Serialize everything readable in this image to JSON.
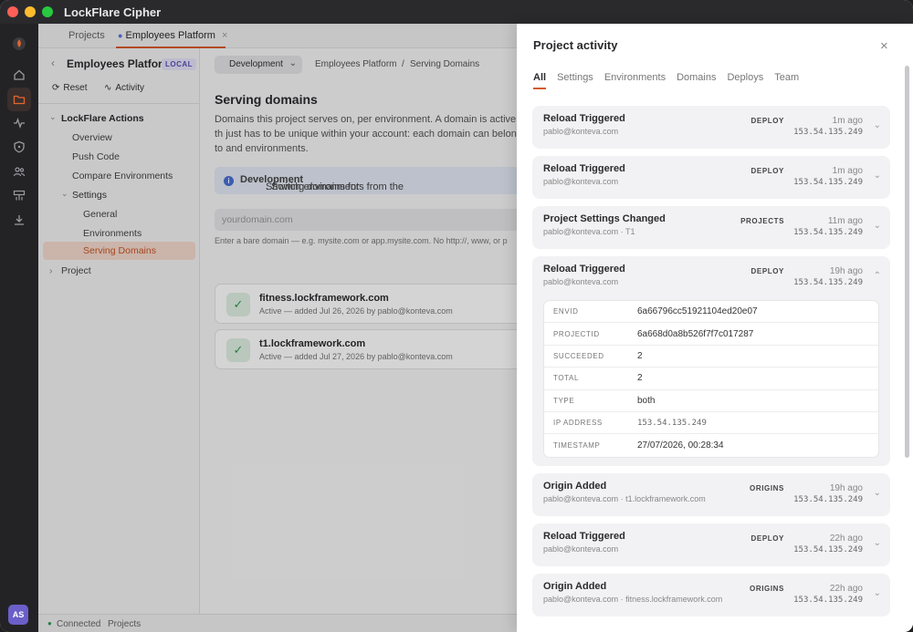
{
  "app": {
    "title": "LockFlare Cipher",
    "avatar": "AS"
  },
  "tabs": [
    {
      "label": "Projects"
    },
    {
      "label": "Employees Platform",
      "close": "×"
    }
  ],
  "sidebar": {
    "project_title": "Employees Platform",
    "badge": "LOCAL",
    "reset": "Reset",
    "activity": "Activity",
    "tree": [
      {
        "label": "LockFlare Actions"
      },
      {
        "label": "Overview"
      },
      {
        "label": "Push Code"
      },
      {
        "label": "Compare Environments"
      },
      {
        "label": "Settings"
      },
      {
        "label": "General"
      },
      {
        "label": "Environments"
      },
      {
        "label": "Serving Domains"
      },
      {
        "label": "Project"
      }
    ]
  },
  "main": {
    "env_button": "Development",
    "breadcrumb": [
      "Employees Platform",
      "/",
      "Serving Domains"
    ],
    "heading": "Serving domains",
    "description": "Domains this project serves on, per environment. A domain is active th just has to be unique within your account: each domain can belong to and environments.",
    "info_prefix": "Showing domains for ",
    "info_env": "Development",
    "info_suffix": ". Switch environments from the",
    "domain_placeholder": "yourdomain.com",
    "hint": "Enter a bare domain — e.g. mysite.com or app.mysite.com. No http://, www, or p",
    "domains": [
      {
        "name": "fitness.lockframework.com",
        "sub": "Active — added Jul 26, 2026 by pablo@konteva.com"
      },
      {
        "name": "t1.lockframework.com",
        "sub": "Active — added Jul 27, 2026 by pablo@konteva.com"
      }
    ]
  },
  "statusbar": {
    "connected": "Connected",
    "projects": "Projects"
  },
  "panel": {
    "title": "Project activity",
    "tabs": [
      "All",
      "Settings",
      "Environments",
      "Domains",
      "Deploys",
      "Team"
    ],
    "events": [
      {
        "title": "Reload Triggered",
        "sub": "pablo@konteva.com",
        "badge": "DEPLOY",
        "time": "1m ago",
        "ip": "153.54.135.249"
      },
      {
        "title": "Reload Triggered",
        "sub": "pablo@konteva.com",
        "badge": "DEPLOY",
        "time": "1m ago",
        "ip": "153.54.135.249"
      },
      {
        "title": "Project Settings Changed",
        "sub": "pablo@konteva.com · T1",
        "badge": "PROJECTS",
        "time": "11m ago",
        "ip": "153.54.135.249"
      },
      {
        "title": "Reload Triggered",
        "sub": "pablo@konteva.com",
        "badge": "DEPLOY",
        "time": "19h ago",
        "ip": "153.54.135.249"
      },
      {
        "title": "Origin Added",
        "sub": "pablo@konteva.com · t1.lockframework.com",
        "badge": "ORIGINS",
        "time": "19h ago",
        "ip": "153.54.135.249"
      },
      {
        "title": "Reload Triggered",
        "sub": "pablo@konteva.com",
        "badge": "DEPLOY",
        "time": "22h ago",
        "ip": "153.54.135.249"
      },
      {
        "title": "Origin Added",
        "sub": "pablo@konteva.com · fitness.lockframework.com",
        "badge": "ORIGINS",
        "time": "22h ago",
        "ip": "153.54.135.249"
      }
    ],
    "details": [
      {
        "k": "ENVID",
        "v": "6a66796cc51921104ed20e07"
      },
      {
        "k": "PROJECTID",
        "v": "6a668d0a8b526f7f7c017287"
      },
      {
        "k": "SUCCEEDED",
        "v": "2"
      },
      {
        "k": "TOTAL",
        "v": "2"
      },
      {
        "k": "TYPE",
        "v": "both"
      },
      {
        "k": "IP ADDRESS",
        "v": "153.54.135.249"
      },
      {
        "k": "TIMESTAMP",
        "v": "27/07/2026, 00:28:34"
      }
    ]
  }
}
